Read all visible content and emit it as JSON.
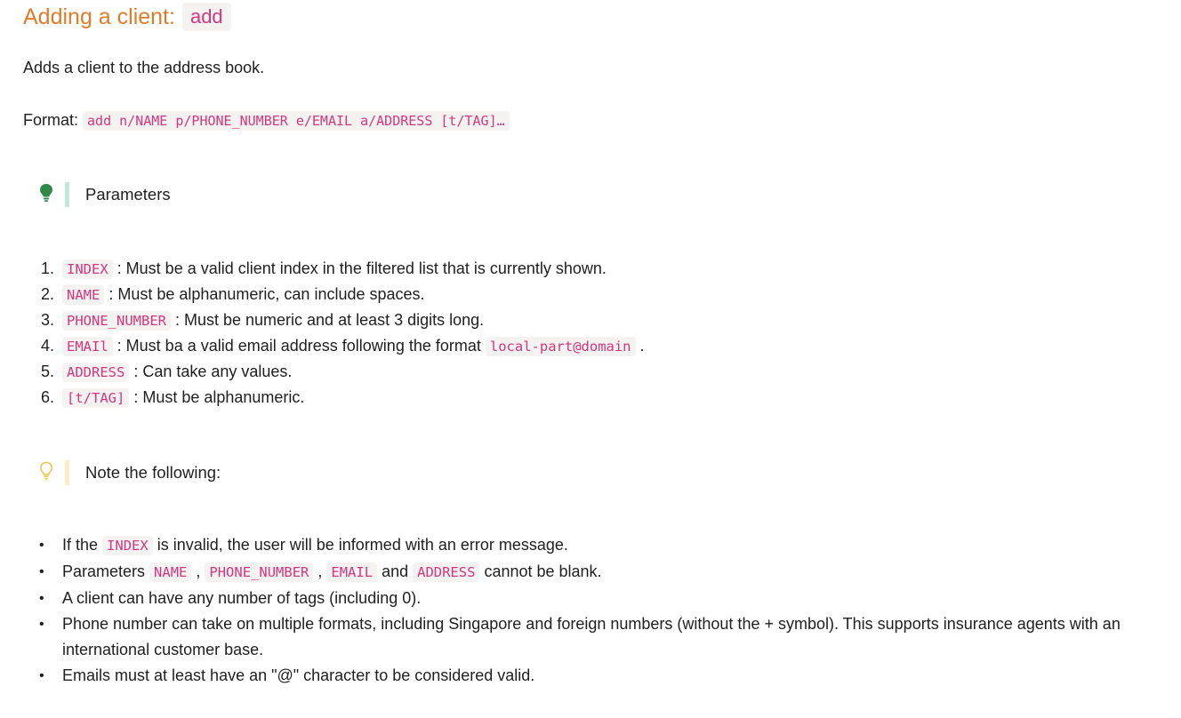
{
  "heading": {
    "text": "Adding a client:",
    "command": "add"
  },
  "description": "Adds a client to the address book.",
  "format": {
    "label": "Format:",
    "code": "add n/NAME p/PHONE_NUMBER e/EMAIL a/ADDRESS [t/TAG]…"
  },
  "callout_params": {
    "icon": "lightbulb-filled-icon",
    "label": "Parameters",
    "bar_color": "#c8e4da",
    "icon_color": "#2f8a4a"
  },
  "params": [
    {
      "num": "1.",
      "code": "INDEX",
      "text": " : Must be a valid client index in the filtered list that is currently shown."
    },
    {
      "num": "2.",
      "code": "NAME",
      "text": " : Must be alphanumeric, can include spaces."
    },
    {
      "num": "3.",
      "code": "PHONE_NUMBER",
      "text": " : Must be numeric and at least 3 digits long."
    },
    {
      "num": "4.",
      "code": "EMAIl",
      "text": " : Must ba a valid email address following the format ",
      "code2": "local-part@domain",
      "text2": " ."
    },
    {
      "num": "5.",
      "code": "ADDRESS",
      "text": " : Can take any values."
    },
    {
      "num": "6.",
      "code": "[t/TAG]",
      "text": " : Must be alphanumeric."
    }
  ],
  "callout_note": {
    "icon": "lightbulb-outline-icon",
    "label": "Note the following:",
    "bar_color": "#fbefc0",
    "icon_color": "#e8c44a"
  },
  "notes": {
    "n1": {
      "a": "If the ",
      "code": "INDEX",
      "b": " is invalid, the user will be informed with an error message."
    },
    "n2": {
      "a": "Parameters ",
      "c1": "NAME",
      "s1": " , ",
      "c2": "PHONE_NUMBER",
      "s2": " , ",
      "c3": "EMAIL",
      "s3": " and ",
      "c4": "ADDRESS",
      "b": " cannot be blank."
    },
    "n3": "A client can have any number of tags (including 0).",
    "n4": "Phone number can take on multiple formats, including Singapore and foreign numbers (without the + symbol). This supports insurance agents with an international customer base.",
    "n5": "Emails must at least have an \"@\" character to be considered valid."
  }
}
